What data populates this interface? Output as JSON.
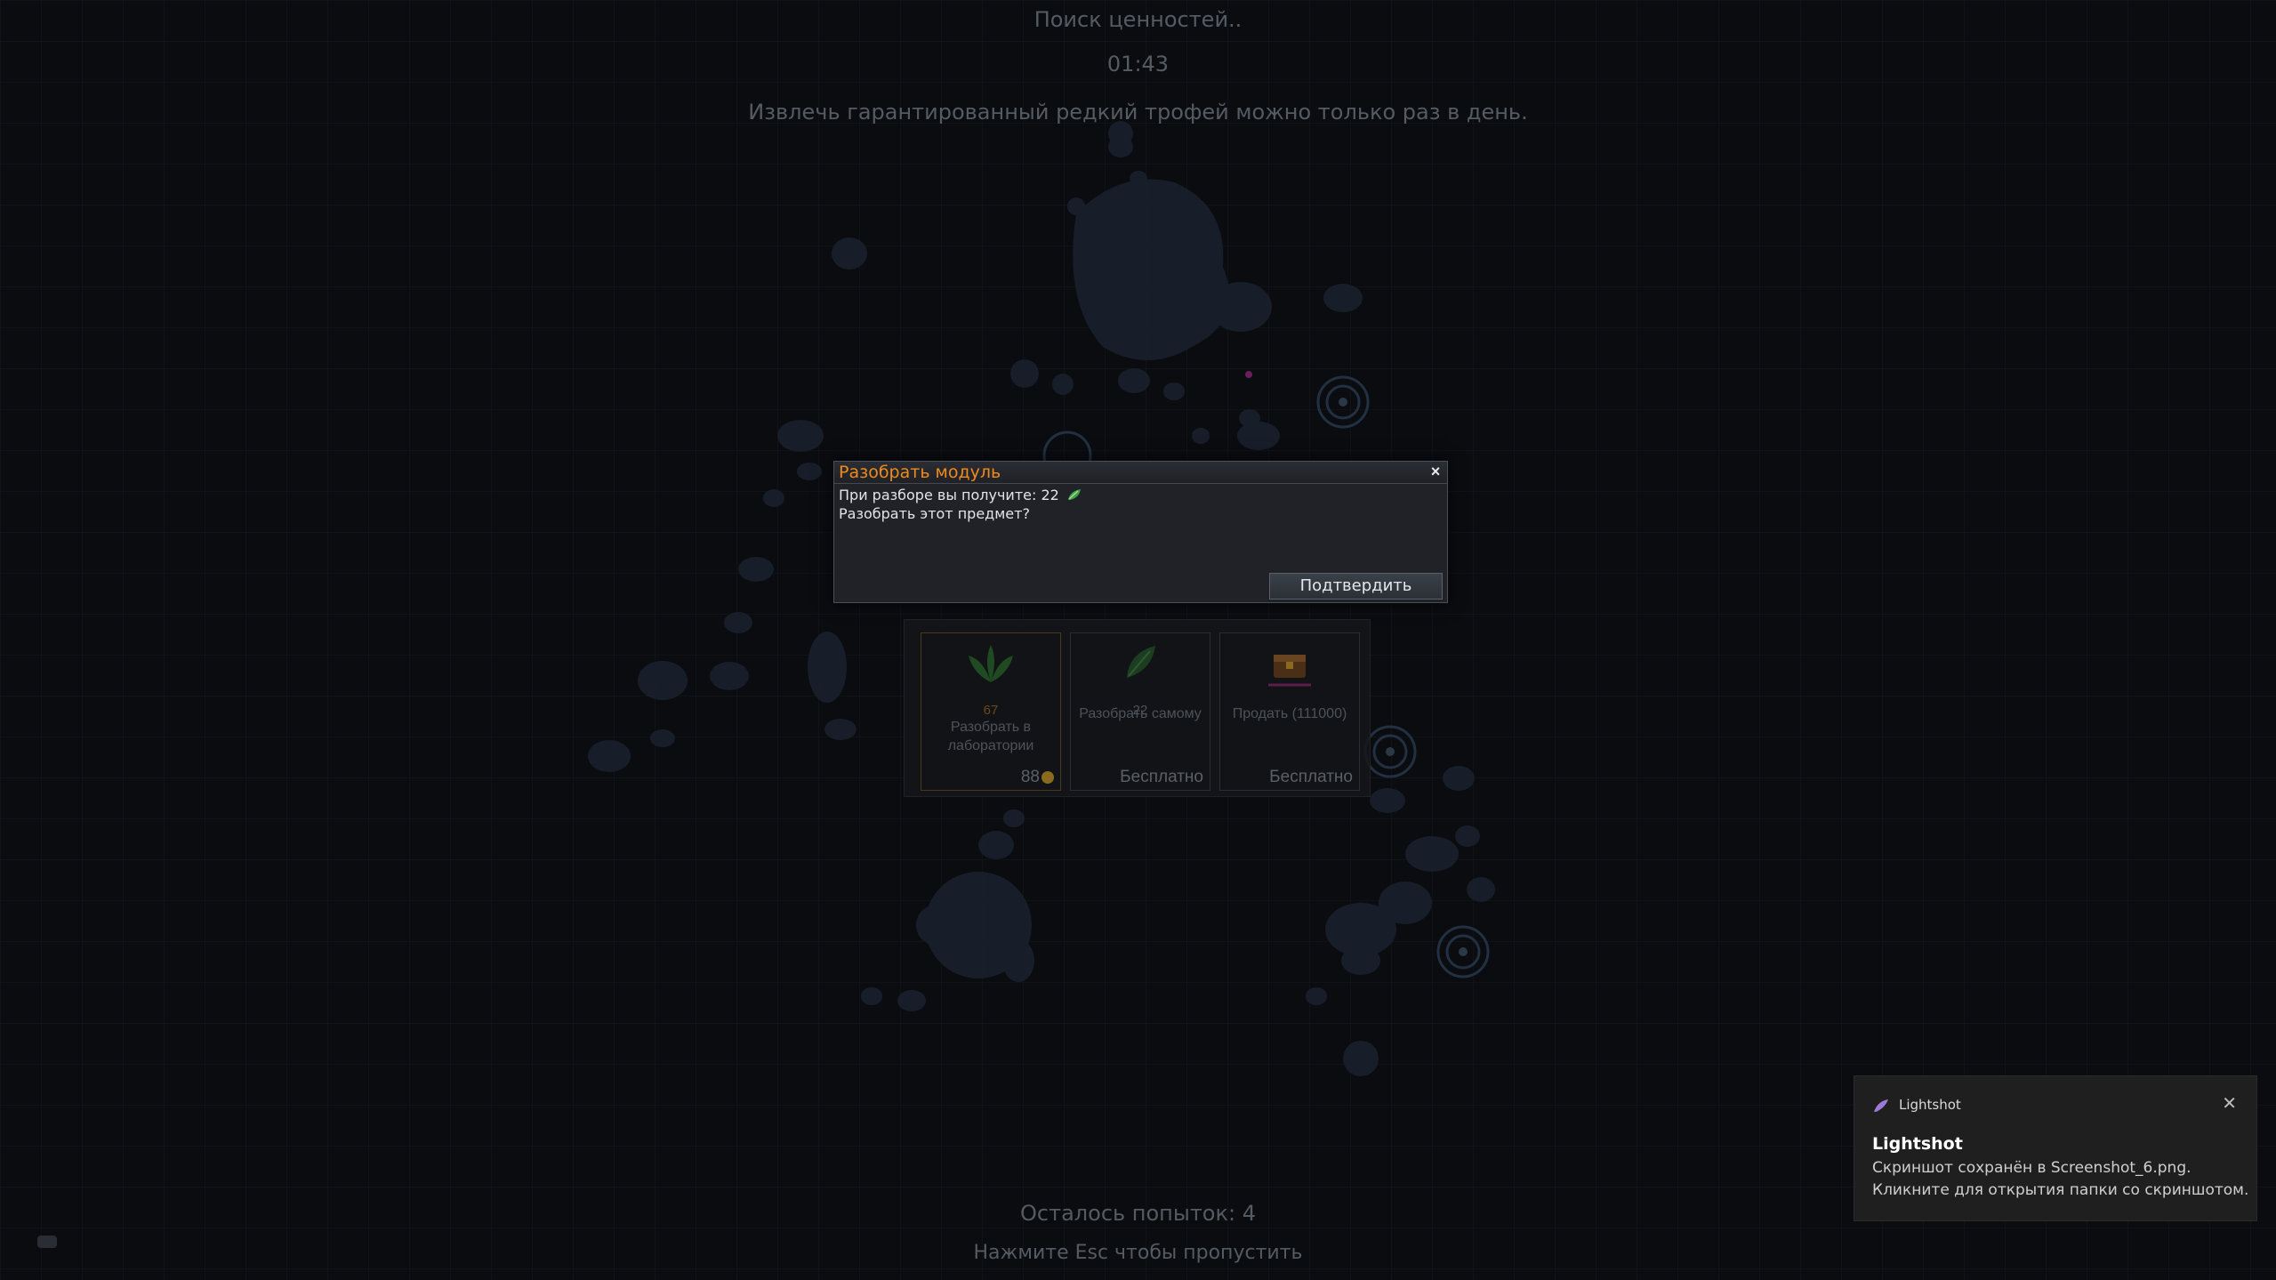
{
  "header": {
    "search_title": "Поиск ценностей..",
    "timer": "01:43",
    "info": "Извлечь гарантированный редкий трофей можно только раз в день."
  },
  "dialog": {
    "title": "Разобрать модуль",
    "close_icon": "close-icon",
    "line1": "При разборе вы получите: 22",
    "line2": "Разобрать этот предмет?",
    "confirm_label": "Подтвердить"
  },
  "choices": [
    {
      "count": "67",
      "label": "Разобрать в лаборатории",
      "cost": "88",
      "icon": "leaf-icon"
    },
    {
      "count": "22",
      "label": "Разобрать самому",
      "cost": "Бесплатно",
      "icon": "leaf-icon"
    },
    {
      "count": "",
      "label": "Продать (111000)",
      "cost": "Бесплатно",
      "icon": "chest-icon"
    }
  ],
  "footer": {
    "attempts": "Осталось попыток: 4",
    "skip_hint": "Нажмите Esc чтобы пропустить"
  },
  "toast": {
    "app_name": "Lightshot",
    "title": "Lightshot",
    "body_line1": "Скриншот сохранён в Screenshot_6.png.",
    "body_line2": "Кликните для открытия папки со скриншотом."
  },
  "colors": {
    "dialog_title": "#f08a1c",
    "leaf": "#3fa14a",
    "map_blobs": "#1e2633"
  }
}
